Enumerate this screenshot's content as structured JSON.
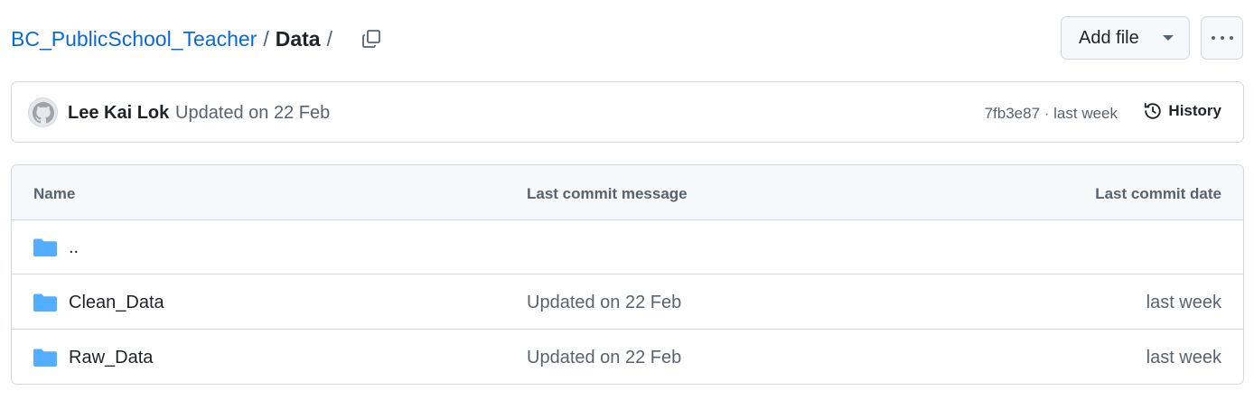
{
  "breadcrumb": {
    "repo": "BC_PublicSchool_Teacher",
    "separator": "/",
    "current": "Data",
    "trailing_separator": "/"
  },
  "actions": {
    "add_file_label": "Add file",
    "copy_icon": "copy-icon",
    "more_icon": "kebab-horizontal-icon"
  },
  "commit": {
    "author": "Lee Kai Lok",
    "message": "Updated on 22 Feb",
    "sha_and_time": "7fb3e87 · last week",
    "history_label": "History",
    "avatar_icon": "github-avatar-icon",
    "history_icon": "history-clock-icon"
  },
  "table": {
    "headers": {
      "name": "Name",
      "message": "Last commit message",
      "date": "Last commit date"
    },
    "rows": [
      {
        "name": "..",
        "message": "",
        "date": "",
        "icon": "folder-icon"
      },
      {
        "name": "Clean_Data",
        "message": "Updated on 22 Feb",
        "date": "last week",
        "icon": "folder-icon"
      },
      {
        "name": "Raw_Data",
        "message": "Updated on 22 Feb",
        "date": "last week",
        "icon": "folder-icon"
      }
    ]
  },
  "colors": {
    "link": "#0969da",
    "folder": "#54aeff",
    "muted_text": "#59636e",
    "border": "#d1d9e0",
    "header_bg": "#f6f8fa"
  }
}
